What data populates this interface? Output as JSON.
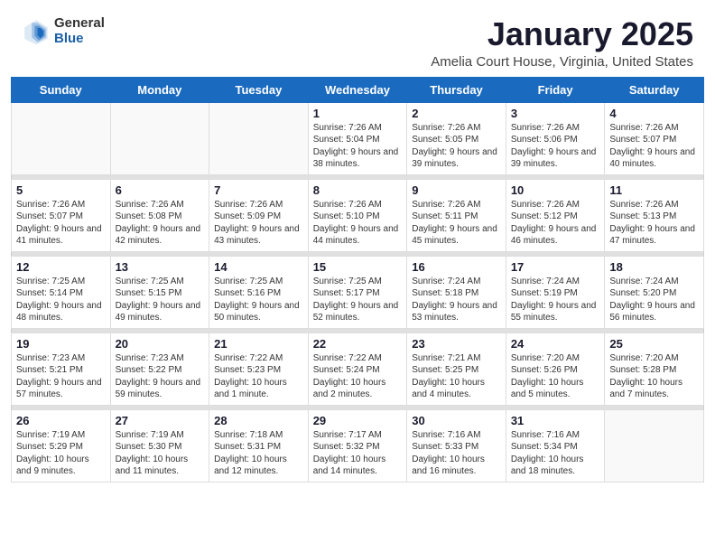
{
  "header": {
    "logo_general": "General",
    "logo_blue": "Blue",
    "month_title": "January 2025",
    "location": "Amelia Court House, Virginia, United States"
  },
  "days_of_week": [
    "Sunday",
    "Monday",
    "Tuesday",
    "Wednesday",
    "Thursday",
    "Friday",
    "Saturday"
  ],
  "weeks": [
    [
      {
        "day": "",
        "empty": true
      },
      {
        "day": "",
        "empty": true
      },
      {
        "day": "",
        "empty": true
      },
      {
        "day": "1",
        "sunrise": "7:26 AM",
        "sunset": "5:04 PM",
        "daylight": "9 hours and 38 minutes."
      },
      {
        "day": "2",
        "sunrise": "7:26 AM",
        "sunset": "5:05 PM",
        "daylight": "9 hours and 39 minutes."
      },
      {
        "day": "3",
        "sunrise": "7:26 AM",
        "sunset": "5:06 PM",
        "daylight": "9 hours and 39 minutes."
      },
      {
        "day": "4",
        "sunrise": "7:26 AM",
        "sunset": "5:07 PM",
        "daylight": "9 hours and 40 minutes."
      }
    ],
    [
      {
        "day": "5",
        "sunrise": "7:26 AM",
        "sunset": "5:07 PM",
        "daylight": "9 hours and 41 minutes."
      },
      {
        "day": "6",
        "sunrise": "7:26 AM",
        "sunset": "5:08 PM",
        "daylight": "9 hours and 42 minutes."
      },
      {
        "day": "7",
        "sunrise": "7:26 AM",
        "sunset": "5:09 PM",
        "daylight": "9 hours and 43 minutes."
      },
      {
        "day": "8",
        "sunrise": "7:26 AM",
        "sunset": "5:10 PM",
        "daylight": "9 hours and 44 minutes."
      },
      {
        "day": "9",
        "sunrise": "7:26 AM",
        "sunset": "5:11 PM",
        "daylight": "9 hours and 45 minutes."
      },
      {
        "day": "10",
        "sunrise": "7:26 AM",
        "sunset": "5:12 PM",
        "daylight": "9 hours and 46 minutes."
      },
      {
        "day": "11",
        "sunrise": "7:26 AM",
        "sunset": "5:13 PM",
        "daylight": "9 hours and 47 minutes."
      }
    ],
    [
      {
        "day": "12",
        "sunrise": "7:25 AM",
        "sunset": "5:14 PM",
        "daylight": "9 hours and 48 minutes."
      },
      {
        "day": "13",
        "sunrise": "7:25 AM",
        "sunset": "5:15 PM",
        "daylight": "9 hours and 49 minutes."
      },
      {
        "day": "14",
        "sunrise": "7:25 AM",
        "sunset": "5:16 PM",
        "daylight": "9 hours and 50 minutes."
      },
      {
        "day": "15",
        "sunrise": "7:25 AM",
        "sunset": "5:17 PM",
        "daylight": "9 hours and 52 minutes."
      },
      {
        "day": "16",
        "sunrise": "7:24 AM",
        "sunset": "5:18 PM",
        "daylight": "9 hours and 53 minutes."
      },
      {
        "day": "17",
        "sunrise": "7:24 AM",
        "sunset": "5:19 PM",
        "daylight": "9 hours and 55 minutes."
      },
      {
        "day": "18",
        "sunrise": "7:24 AM",
        "sunset": "5:20 PM",
        "daylight": "9 hours and 56 minutes."
      }
    ],
    [
      {
        "day": "19",
        "sunrise": "7:23 AM",
        "sunset": "5:21 PM",
        "daylight": "9 hours and 57 minutes."
      },
      {
        "day": "20",
        "sunrise": "7:23 AM",
        "sunset": "5:22 PM",
        "daylight": "9 hours and 59 minutes."
      },
      {
        "day": "21",
        "sunrise": "7:22 AM",
        "sunset": "5:23 PM",
        "daylight": "10 hours and 1 minute."
      },
      {
        "day": "22",
        "sunrise": "7:22 AM",
        "sunset": "5:24 PM",
        "daylight": "10 hours and 2 minutes."
      },
      {
        "day": "23",
        "sunrise": "7:21 AM",
        "sunset": "5:25 PM",
        "daylight": "10 hours and 4 minutes."
      },
      {
        "day": "24",
        "sunrise": "7:20 AM",
        "sunset": "5:26 PM",
        "daylight": "10 hours and 5 minutes."
      },
      {
        "day": "25",
        "sunrise": "7:20 AM",
        "sunset": "5:28 PM",
        "daylight": "10 hours and 7 minutes."
      }
    ],
    [
      {
        "day": "26",
        "sunrise": "7:19 AM",
        "sunset": "5:29 PM",
        "daylight": "10 hours and 9 minutes."
      },
      {
        "day": "27",
        "sunrise": "7:19 AM",
        "sunset": "5:30 PM",
        "daylight": "10 hours and 11 minutes."
      },
      {
        "day": "28",
        "sunrise": "7:18 AM",
        "sunset": "5:31 PM",
        "daylight": "10 hours and 12 minutes."
      },
      {
        "day": "29",
        "sunrise": "7:17 AM",
        "sunset": "5:32 PM",
        "daylight": "10 hours and 14 minutes."
      },
      {
        "day": "30",
        "sunrise": "7:16 AM",
        "sunset": "5:33 PM",
        "daylight": "10 hours and 16 minutes."
      },
      {
        "day": "31",
        "sunrise": "7:16 AM",
        "sunset": "5:34 PM",
        "daylight": "10 hours and 18 minutes."
      },
      {
        "day": "",
        "empty": true
      }
    ]
  ]
}
